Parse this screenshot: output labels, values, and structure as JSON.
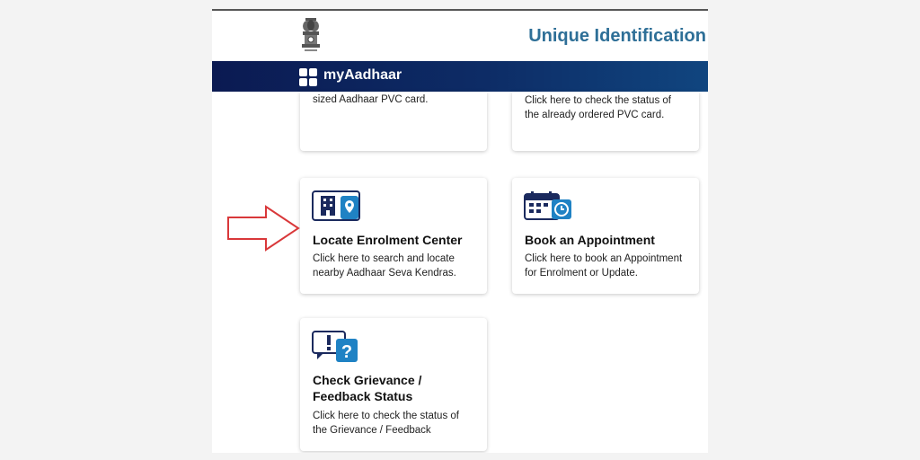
{
  "header": {
    "title": "Unique Identification"
  },
  "nav": {
    "title": "myAadhaar"
  },
  "cards": {
    "order_pvc": {
      "desc": "sized Aadhaar PVC card."
    },
    "check_pvc": {
      "desc": "Click here to check the status of the already ordered PVC card."
    },
    "locate": {
      "title": "Locate Enrolment Center",
      "desc": "Click here to search and locate nearby Aadhaar Seva Kendras.",
      "icon": "building-location-icon"
    },
    "appointment": {
      "title": "Book an Appointment",
      "desc": "Click here to book an Appointment for Enrolment or Update.",
      "icon": "calendar-clock-icon"
    },
    "grievance": {
      "title": "Check Grievance / Feedback Status",
      "desc": "Click here to check the status of the Grievance / Feedback",
      "icon": "alert-question-icon"
    }
  },
  "colors": {
    "title": "#2e6f97",
    "nav_start": "#0b1a52",
    "nav_end": "#10457f",
    "icon_navy": "#1b2a5e",
    "icon_blue": "#1f82c4",
    "arrow": "#d9383a"
  }
}
